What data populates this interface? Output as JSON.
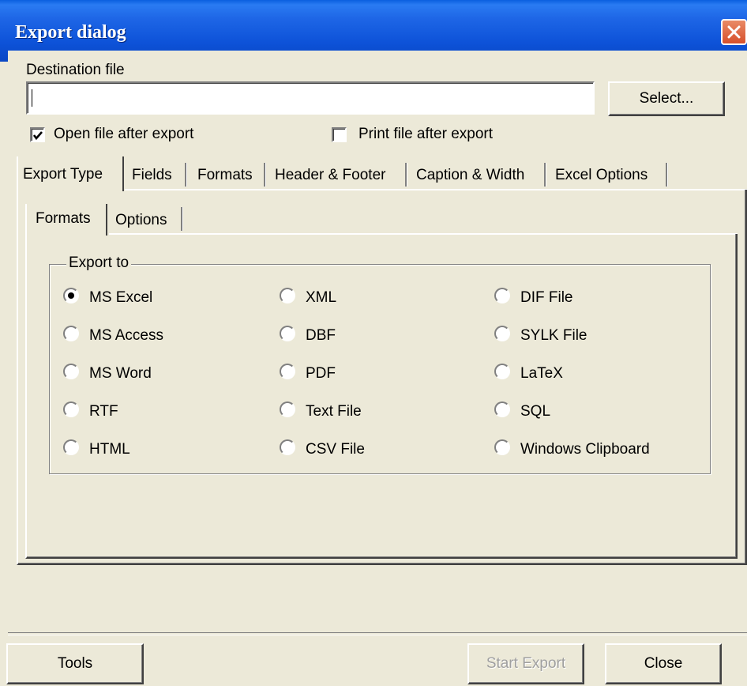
{
  "window": {
    "title": "Export dialog"
  },
  "destination": {
    "label": "Destination file",
    "value": "",
    "select_label": "Select..."
  },
  "options": {
    "open_after_export": {
      "label": "Open file after export",
      "checked": true
    },
    "print_after_export": {
      "label": "Print file after export",
      "checked": false
    }
  },
  "main_tabs": [
    {
      "label": "Export Type",
      "active": true
    },
    {
      "label": "Fields"
    },
    {
      "label": "Formats"
    },
    {
      "label": "Header & Footer"
    },
    {
      "label": "Caption & Width"
    },
    {
      "label": "Excel Options"
    }
  ],
  "sub_tabs": [
    {
      "label": "Formats",
      "active": true
    },
    {
      "label": "Options"
    }
  ],
  "export_to": {
    "title": "Export to",
    "selected": "MS Excel",
    "columns": [
      [
        "MS Excel",
        "MS Access",
        "MS Word",
        "RTF",
        "HTML"
      ],
      [
        "XML",
        "DBF",
        "PDF",
        "Text File",
        "CSV File"
      ],
      [
        "DIF File",
        "SYLK File",
        "LaTeX",
        "SQL",
        "Windows Clipboard"
      ]
    ]
  },
  "footer": {
    "tools_label": "Tools",
    "start_label": "Start Export",
    "close_label": "Close"
  }
}
